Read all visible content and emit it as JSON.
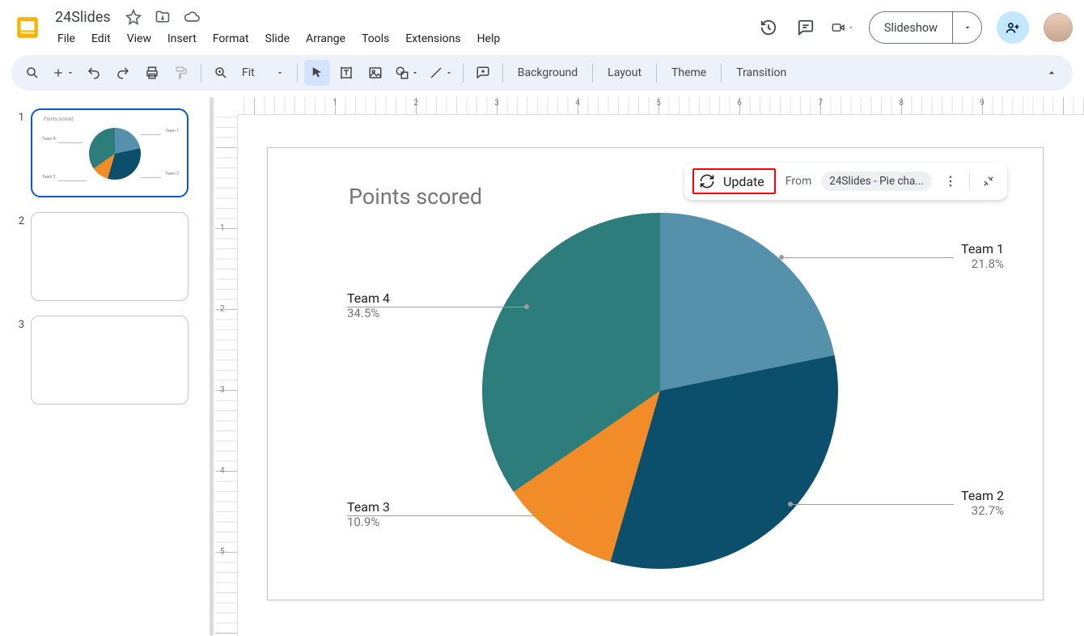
{
  "app": {
    "doc_title": "24Slides"
  },
  "menu": {
    "file": "File",
    "edit": "Edit",
    "view": "View",
    "insert": "Insert",
    "format": "Format",
    "slide": "Slide",
    "arrange": "Arrange",
    "tools": "Tools",
    "extensions": "Extensions",
    "help": "Help"
  },
  "header": {
    "slideshow": "Slideshow"
  },
  "toolbar": {
    "zoom_label": "Fit",
    "background": "Background",
    "layout": "Layout",
    "theme": "Theme",
    "transition": "Transition"
  },
  "ruler": {
    "h": [
      "1",
      "2",
      "3",
      "4",
      "5",
      "6",
      "7",
      "8",
      "9"
    ],
    "v": [
      "1",
      "2",
      "3",
      "4",
      "5"
    ]
  },
  "slides": {
    "count": 3,
    "active": 1
  },
  "chart_overlay": {
    "update": "Update",
    "from": "From",
    "source": "24Slides - Pie cha..."
  },
  "chart_data": {
    "type": "pie",
    "title": "Points scored",
    "series": [
      {
        "name": "Team 1",
        "value": 21.8,
        "pct": "21.8%",
        "color": "#5591aa"
      },
      {
        "name": "Team 2",
        "value": 32.7,
        "pct": "32.7%",
        "color": "#0b4f6c"
      },
      {
        "name": "Team 3",
        "value": 10.9,
        "pct": "10.9%",
        "color": "#f28c28"
      },
      {
        "name": "Team 4",
        "value": 34.5,
        "pct": "34.5%",
        "color": "#2e7d7d"
      }
    ]
  }
}
